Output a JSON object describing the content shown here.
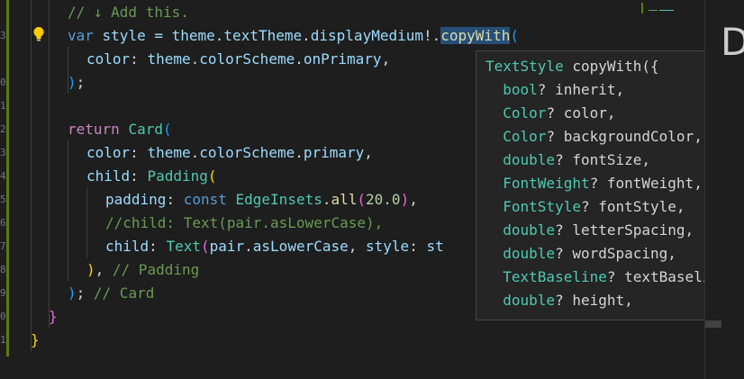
{
  "editor": {
    "lines": [
      {
        "tokens": [
          {
            "t": "// ↓ Add this.",
            "c": "cm"
          }
        ]
      },
      {
        "tokens": [
          {
            "t": "var",
            "c": "kw"
          },
          {
            "t": " style = ",
            "c": "var"
          },
          {
            "t": "theme",
            "c": "var"
          },
          {
            "t": ".",
            "c": "pun"
          },
          {
            "t": "textTheme",
            "c": "var"
          },
          {
            "t": ".",
            "c": "pun"
          },
          {
            "t": "displayMedium",
            "c": "var"
          },
          {
            "t": "!.",
            "c": "pun"
          },
          {
            "t": "copyWith",
            "c": "fn sel"
          },
          {
            "t": "(",
            "c": "br3"
          }
        ]
      },
      {
        "tokens": [
          {
            "t": "color",
            "c": "var"
          },
          {
            "t": ": ",
            "c": "pun"
          },
          {
            "t": "theme",
            "c": "var"
          },
          {
            "t": ".",
            "c": "pun"
          },
          {
            "t": "colorScheme",
            "c": "var"
          },
          {
            "t": ".",
            "c": "pun"
          },
          {
            "t": "onPrimary",
            "c": "var"
          },
          {
            "t": ",",
            "c": "pun"
          }
        ]
      },
      {
        "tokens": [
          {
            "t": ")",
            "c": "br3"
          },
          {
            "t": ";",
            "c": "pun"
          }
        ]
      },
      {
        "tokens": []
      },
      {
        "tokens": [
          {
            "t": "return",
            "c": "ctl"
          },
          {
            "t": " ",
            "c": "pun"
          },
          {
            "t": "Card",
            "c": "type"
          },
          {
            "t": "(",
            "c": "br3"
          }
        ]
      },
      {
        "tokens": [
          {
            "t": "color",
            "c": "var"
          },
          {
            "t": ": ",
            "c": "pun"
          },
          {
            "t": "theme",
            "c": "var"
          },
          {
            "t": ".",
            "c": "pun"
          },
          {
            "t": "colorScheme",
            "c": "var"
          },
          {
            "t": ".",
            "c": "pun"
          },
          {
            "t": "primary",
            "c": "var"
          },
          {
            "t": ",",
            "c": "pun"
          }
        ]
      },
      {
        "tokens": [
          {
            "t": "child",
            "c": "var"
          },
          {
            "t": ": ",
            "c": "pun"
          },
          {
            "t": "Padding",
            "c": "type"
          },
          {
            "t": "(",
            "c": "br1"
          }
        ]
      },
      {
        "tokens": [
          {
            "t": "padding",
            "c": "var"
          },
          {
            "t": ": ",
            "c": "pun"
          },
          {
            "t": "const",
            "c": "kw"
          },
          {
            "t": " ",
            "c": "pun"
          },
          {
            "t": "EdgeInsets",
            "c": "type"
          },
          {
            "t": ".",
            "c": "pun"
          },
          {
            "t": "all",
            "c": "fn"
          },
          {
            "t": "(",
            "c": "br2"
          },
          {
            "t": "20.0",
            "c": "num"
          },
          {
            "t": ")",
            "c": "br2"
          },
          {
            "t": ",",
            "c": "pun"
          }
        ]
      },
      {
        "tokens": [
          {
            "t": "//child: Text(pair.asLowerCase),",
            "c": "cm"
          }
        ]
      },
      {
        "tokens": [
          {
            "t": "child",
            "c": "var"
          },
          {
            "t": ": ",
            "c": "pun"
          },
          {
            "t": "Text",
            "c": "type"
          },
          {
            "t": "(",
            "c": "br2"
          },
          {
            "t": "pair",
            "c": "var"
          },
          {
            "t": ".",
            "c": "pun"
          },
          {
            "t": "asLowerCase",
            "c": "var"
          },
          {
            "t": ", ",
            "c": "pun"
          },
          {
            "t": "style",
            "c": "var"
          },
          {
            "t": ": ",
            "c": "pun"
          },
          {
            "t": "st",
            "c": "var"
          }
        ]
      },
      {
        "tokens": [
          {
            "t": ")",
            "c": "br1"
          },
          {
            "t": ", ",
            "c": "pun"
          },
          {
            "t": "// Padding",
            "c": "cm"
          }
        ]
      },
      {
        "tokens": [
          {
            "t": ")",
            "c": "br3"
          },
          {
            "t": "; ",
            "c": "pun"
          },
          {
            "t": "// Card",
            "c": "cm"
          }
        ]
      },
      {
        "tokens": [
          {
            "t": "}",
            "c": "br2"
          }
        ]
      },
      {
        "tokens": [
          {
            "t": "}",
            "c": "br1"
          }
        ]
      }
    ],
    "line_numbers": [
      "",
      "3",
      "",
      "0",
      "1",
      "2",
      "3",
      "4",
      "5",
      "6",
      "7",
      "8",
      "9",
      "0",
      "1"
    ]
  },
  "tooltip": {
    "lines": [
      {
        "tokens": [
          {
            "t": "TextStyle",
            "c": "type"
          },
          {
            "t": " copyWith({",
            "c": "pun"
          }
        ]
      },
      {
        "tokens": [
          {
            "t": "  ",
            "c": "pun"
          },
          {
            "t": "bool",
            "c": "type"
          },
          {
            "t": "? inherit,",
            "c": "pun"
          }
        ]
      },
      {
        "tokens": [
          {
            "t": "  ",
            "c": "pun"
          },
          {
            "t": "Color",
            "c": "type"
          },
          {
            "t": "? color,",
            "c": "pun"
          }
        ]
      },
      {
        "tokens": [
          {
            "t": "  ",
            "c": "pun"
          },
          {
            "t": "Color",
            "c": "type"
          },
          {
            "t": "? backgroundColor,",
            "c": "pun"
          }
        ]
      },
      {
        "tokens": [
          {
            "t": "  ",
            "c": "pun"
          },
          {
            "t": "double",
            "c": "type"
          },
          {
            "t": "? fontSize,",
            "c": "pun"
          }
        ]
      },
      {
        "tokens": [
          {
            "t": "  ",
            "c": "pun"
          },
          {
            "t": "FontWeight",
            "c": "type"
          },
          {
            "t": "? fontWeight,",
            "c": "pun"
          }
        ]
      },
      {
        "tokens": [
          {
            "t": "  ",
            "c": "pun"
          },
          {
            "t": "FontStyle",
            "c": "type"
          },
          {
            "t": "? fontStyle,",
            "c": "pun"
          }
        ]
      },
      {
        "tokens": [
          {
            "t": "  ",
            "c": "pun"
          },
          {
            "t": "double",
            "c": "type"
          },
          {
            "t": "? letterSpacing,",
            "c": "pun"
          }
        ]
      },
      {
        "tokens": [
          {
            "t": "  ",
            "c": "pun"
          },
          {
            "t": "double",
            "c": "type"
          },
          {
            "t": "? wordSpacing,",
            "c": "pun"
          }
        ]
      },
      {
        "tokens": [
          {
            "t": "  ",
            "c": "pun"
          },
          {
            "t": "TextBaseline",
            "c": "type"
          },
          {
            "t": "? textBaseline",
            "c": "pun"
          }
        ]
      },
      {
        "tokens": [
          {
            "t": "  ",
            "c": "pun"
          },
          {
            "t": "double",
            "c": "type"
          },
          {
            "t": "? height,",
            "c": "pun"
          }
        ]
      }
    ]
  },
  "side_panel": {
    "letter": "D"
  },
  "icons": {
    "lightbulb": "lightbulb-icon"
  },
  "colors": {
    "background": "#1e1e1e",
    "tooltip_bg": "#252526",
    "selection": "#264f78",
    "git_modified": "#587c0c"
  }
}
